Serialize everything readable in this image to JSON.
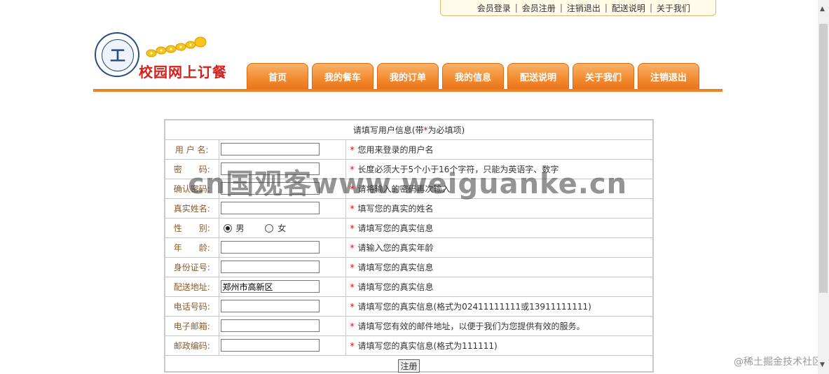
{
  "topbar": {
    "links": [
      "会员登录",
      "会员注册",
      "注销退出",
      "配送说明",
      "关于我们"
    ],
    "separator": "|"
  },
  "logo": {
    "site_name": "校园网上订餐",
    "emblem_icon": "university-emblem-icon",
    "ornament_icon": "coin-ornament-icon"
  },
  "nav": {
    "tabs": [
      "首页",
      "我的餐车",
      "我的订单",
      "我的信息",
      "配送说明",
      "关于我们",
      "注销退出"
    ]
  },
  "form": {
    "header_prefix": "请填写用户信息(带",
    "header_star": "*",
    "header_suffix": "为必填项)",
    "required_mark": "*",
    "rows": [
      {
        "label": "用 户 名:",
        "value": "",
        "tip": "您用来登录的用户名"
      },
      {
        "label": "密　　码:",
        "value": "",
        "tip": "长度必须大于5个小于16个字符，只能为英语字、数字"
      },
      {
        "label": "确认密码:",
        "value": "",
        "tip": "请将输入的密码再次输入"
      },
      {
        "label": "真实姓名:",
        "value": "",
        "tip": "填写您的真实的姓名"
      },
      {
        "label": "性　　别:",
        "tip": "请填写您的真实信息",
        "gender_options": [
          "男",
          "女"
        ],
        "gender_selected": "男"
      },
      {
        "label": "年　　龄:",
        "value": "",
        "tip": "请输入您的真实年龄"
      },
      {
        "label": "身份证号:",
        "value": "",
        "tip": "请填写您的真实信息"
      },
      {
        "label": "配送地址:",
        "value": "郑州市高新区",
        "tip": "请填写您的真实信息"
      },
      {
        "label": "电话号码:",
        "value": "",
        "tip": "请填写您的真实信息(格式为02411111111或13911111111)"
      },
      {
        "label": "电子邮箱:",
        "value": "",
        "tip": "请填写您有效的邮件地址，以便于我们为您提供有效的服务。"
      },
      {
        "label": "邮政编码:",
        "value": "",
        "tip": "请填写您的真实信息(格式为111111)"
      }
    ],
    "submit_label": "注册"
  },
  "watermark": "cn国观客www.weiguanke.cn",
  "corner_credit": "@稀土掘金技术社区",
  "colors": {
    "accent": "#f08020",
    "label": "#8b5a2b",
    "required": "#e00000",
    "site_name": "#d4201a"
  }
}
